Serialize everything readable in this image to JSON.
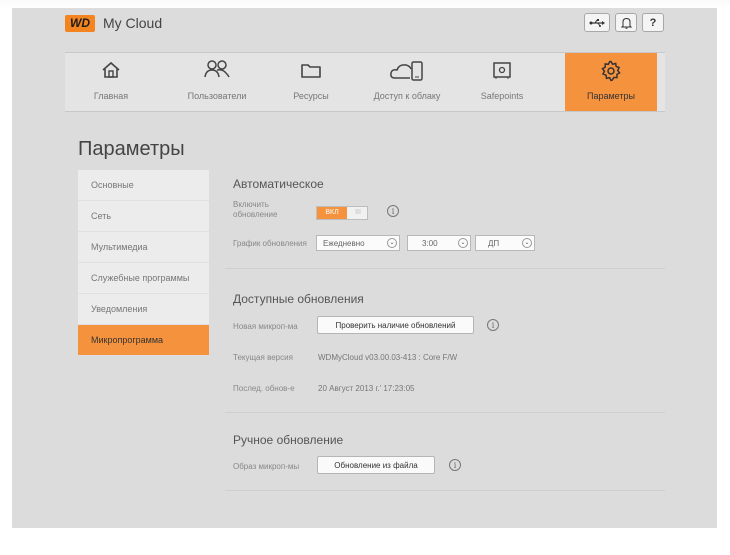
{
  "app": {
    "logo": "WD",
    "title": "My Cloud"
  },
  "topbar": {
    "usb_icon": "usb-icon",
    "bell_icon": "bell-icon",
    "help_label": "?"
  },
  "nav": {
    "items": [
      {
        "label": "Главная",
        "icon": "home-icon"
      },
      {
        "label": "Пользователи",
        "icon": "users-icon"
      },
      {
        "label": "Ресурсы",
        "icon": "folder-icon"
      },
      {
        "label": "Доступ к облаку",
        "icon": "cloud-device-icon"
      },
      {
        "label": "Safepoints",
        "icon": "safe-icon"
      },
      {
        "label": "Параметры",
        "icon": "gear-icon",
        "active": true
      }
    ]
  },
  "page": {
    "title": "Параметры"
  },
  "sidebar": {
    "items": [
      {
        "label": "Основные"
      },
      {
        "label": "Сеть"
      },
      {
        "label": "Мультимедиа"
      },
      {
        "label": "Служебные программы"
      },
      {
        "label": "Уведомления"
      },
      {
        "label": "Микропрограмма",
        "active": true
      }
    ]
  },
  "auto": {
    "title": "Автоматическое",
    "enable_label": "Включить обновление",
    "toggle_on": "ВКЛ",
    "toggle_off": "III",
    "schedule_label": "График обновления",
    "frequency": "Ежедневно",
    "time": "3:00",
    "ampm": "ДП"
  },
  "available": {
    "title": "Доступные обновления",
    "new_fw_label": "Новая микроп-ма",
    "check_button": "Проверить наличие обновлений",
    "current_label": "Текущая версия",
    "current_value": "WDMyCloud v03.00.03-413 : Core F/W",
    "last_label": "Послед. обнов-е",
    "last_value": "20 Август 2013 г.' 17:23:05"
  },
  "manual": {
    "title": "Ручное обновление",
    "image_label": "Образ микроп-мы",
    "file_button": "Обновление из файла"
  },
  "colors": {
    "accent": "#f5923e",
    "background": "#dcdcdc"
  }
}
